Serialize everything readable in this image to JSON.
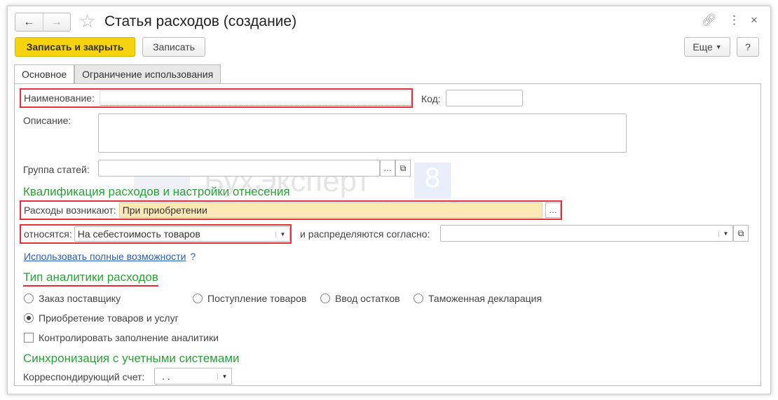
{
  "window": {
    "title": "Статья расходов (создание)"
  },
  "toolbar": {
    "save_close": "Записать и закрыть",
    "save": "Записать",
    "more": "Еще",
    "help": "?"
  },
  "tabs": [
    "Основное",
    "Ограничение использования"
  ],
  "form": {
    "name_label": "Наименование:",
    "name_value": "",
    "code_label": "Код:",
    "code_value": "",
    "desc_label": "Описание:",
    "group_label": "Группа статей:",
    "section1": "Квалификация расходов и настройки отнесения",
    "arise_label": "Расходы возникают:",
    "arise_value": "При приобретении",
    "relate_label": "относятся:",
    "relate_value": "На себестоимость товаров",
    "distribute_label": "и распределяются согласно:",
    "full_link": "Использовать полные возможности",
    "full_help": "?",
    "section2": "Тип аналитики расходов",
    "radios": [
      {
        "label": "Заказ поставщику",
        "checked": false
      },
      {
        "label": "Поступление товаров",
        "checked": false
      },
      {
        "label": "Ввод остатков",
        "checked": false
      },
      {
        "label": "Таможенная декларация",
        "checked": false
      },
      {
        "label": "Приобретение товаров и услуг",
        "checked": true
      }
    ],
    "control_label": "Контролировать заполнение аналитики",
    "section3": "Синхронизация с учетными системами",
    "account_label": "Корреспондирующий счет:",
    "account_value": ". ."
  },
  "watermark": {
    "title": "БухЭксперт",
    "badge": "8",
    "subtitle": "База ответов по учёту в 1С"
  }
}
